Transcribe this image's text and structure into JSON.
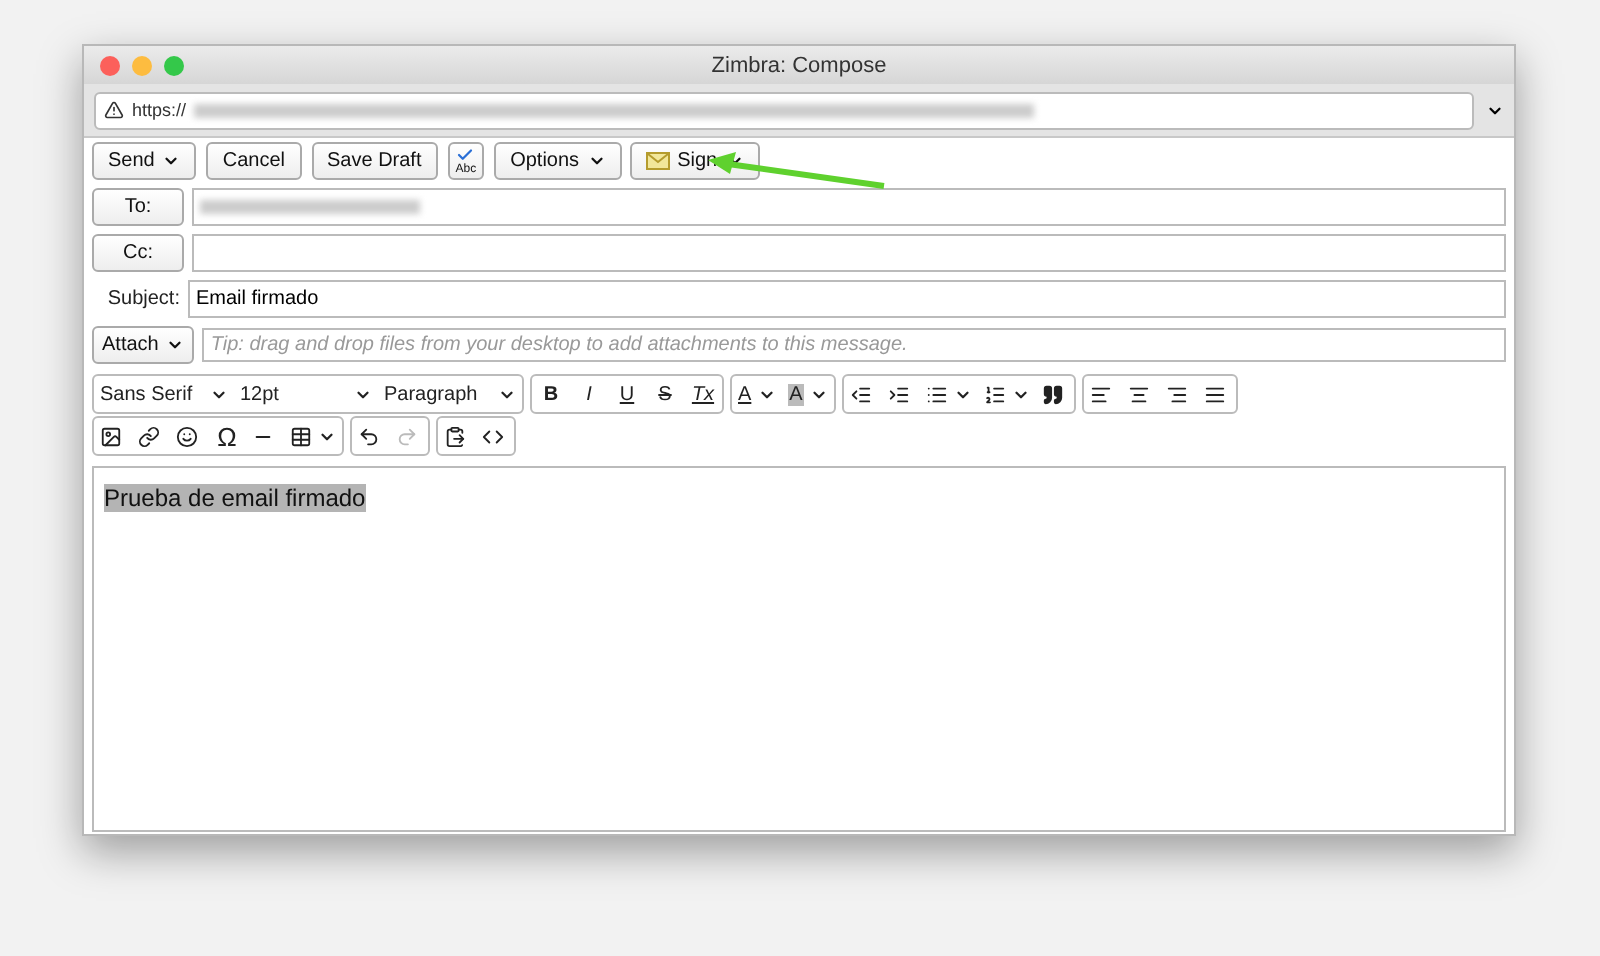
{
  "window": {
    "title": "Zimbra: Compose"
  },
  "address_bar": {
    "url": "https://"
  },
  "toolbar": [
    {
      "label": "Send",
      "kind": "menu"
    },
    {
      "label": "Cancel",
      "kind": "plain"
    },
    {
      "label": "Save Draft",
      "kind": "plain"
    },
    {
      "label": "Abc",
      "kind": "spell"
    },
    {
      "label": "Options",
      "kind": "menu"
    },
    {
      "label": "Sign",
      "kind": "sign"
    }
  ],
  "fields": [
    {
      "label": "To:",
      "kind": "button"
    },
    {
      "label": "Cc:",
      "kind": "button"
    },
    {
      "label": "Subject:",
      "kind": "text",
      "value": "Email firmado"
    }
  ],
  "attach": {
    "label": "Attach",
    "placeholder": "Tip: drag and drop files from your desktop to add attachments to this message."
  },
  "format": {
    "font": "Sans Serif",
    "size": "12pt",
    "block": "Paragraph",
    "styles": [
      "B",
      "I",
      "U",
      "S",
      "Tx"
    ],
    "text_color": "A",
    "highlight": "A",
    "special_char": "Ω"
  },
  "body": {
    "text": "Prueba de email firmado",
    "selected": true
  }
}
